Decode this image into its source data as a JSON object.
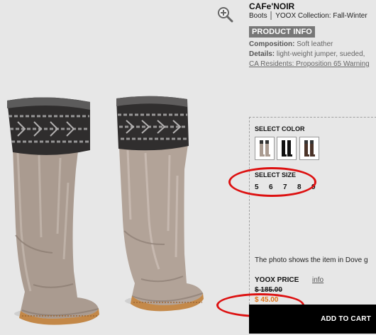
{
  "product": {
    "brand": "CAFe'NOIR",
    "category": "Boots",
    "collection": "YOOX Collection: Fall-Winter",
    "info_badge": "PRODUCT INFO",
    "composition_label": "Composition:",
    "composition_value": "Soft leather",
    "details_label": "Details:",
    "details_value": "light-weight jumper, sueded,",
    "prop65_link": "CA Residents: Proposition 65 Warning"
  },
  "selection": {
    "color_label": "SELECT COLOR",
    "size_label": "SELECT SIZE",
    "sizes": [
      "5",
      "6",
      "7",
      "8",
      "9"
    ],
    "swatch_icons": [
      "beige-boot-icon",
      "black-boot-icon",
      "brown-boot-icon"
    ]
  },
  "note": "The photo shows the item in Dove g",
  "pricing": {
    "label": "YOOX PRICE",
    "info_link": "info",
    "original": "$ 185.00",
    "sale": "$ 45.00"
  },
  "cart": {
    "button_label": "ADD TO CART"
  },
  "colors": {
    "sale_price": "#e07417",
    "annotation_circle": "#d11111",
    "background": "#e7e7e7"
  }
}
